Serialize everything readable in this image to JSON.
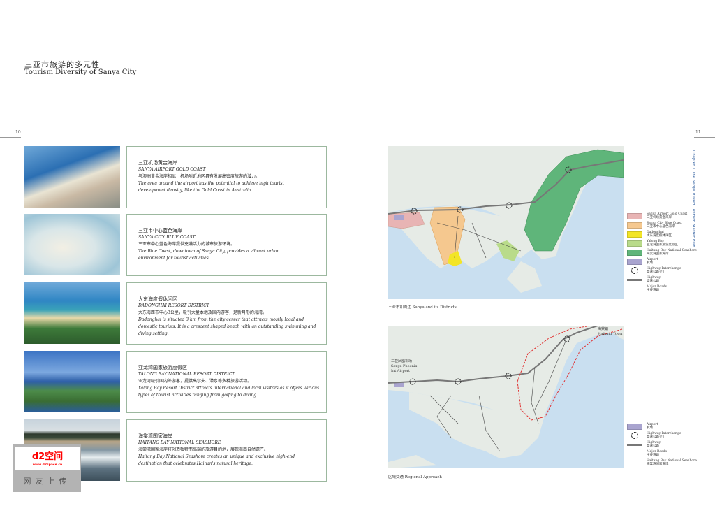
{
  "header": {
    "title_cn": "三亚市旅游的多元性",
    "title_en": "Tourism Diversity of Sanya City",
    "page_left": "10",
    "page_right": "11",
    "side_text": "Chapter 1 The Sanya Resort Tourism Master Plan"
  },
  "districts": [
    {
      "name_cn": "三亚机场黄金海岸",
      "name_en": "SANYA AIRPORT GOLD COAST",
      "desc_cn": "与澳洲黄金海岸相似，机场附近地区具有发展高密度旅游的潜力。",
      "desc_en": "The area around the airport has the potential to achieve high tourist development density, like the Gold Coast in Australia."
    },
    {
      "name_cn": "三亚市中心蓝色海岸",
      "name_en": "SANYA CITY BLUE COAST",
      "desc_cn": "三亚市中心蓝色海岸提供充满活力的城市旅游环境。",
      "desc_en": "The Blue Coast, downtown of Sanya City, provides a vibrant urban environment for tourist activities."
    },
    {
      "name_cn": "大东海度假休闲区",
      "name_en": "DADONGHAI RESORT DISTRICT",
      "desc_cn": "大东海距市中心3公里，吸引大量本地及国内游客，是新月形的海湾。",
      "desc_en": "Dadonghai is situated 3 km from the city center that attracts mostly local and domestic tourists. It is a crescent shaped beach with an outstanding swimming and diving setting."
    },
    {
      "name_cn": "亚龙湾国家旅游度假区",
      "name_en": "YALONG BAY NATIONAL RESORT DISTRICT",
      "desc_cn": "亚龙湾吸引国内外游客，提供高尔夫、潜水等多种旅游活动。",
      "desc_en": "Yalong Bay Resort District attracts international and local visitors as it offers various types of tourist activities ranging from golfing to diving."
    },
    {
      "name_cn": "海棠湾国家海岸",
      "name_en": "HAITANG BAY NATIONAL SEASHORE",
      "desc_cn": "海棠湾国家海岸将创造独特而高端的旅游目的地，展现海南自然遗产。",
      "desc_en": "Haitang Bay National Seashore creates an unique and exclusive high-end destination that celebrates Hainan's natural heritage."
    }
  ],
  "map1": {
    "caption": "三亚市和周边 Sanya and its Districts",
    "legend": [
      {
        "en": "Sanya Airport Gold Coast",
        "cn": "三亚机场黄金海岸",
        "color": "#e8b4b4"
      },
      {
        "en": "Sanya City Blue Coast",
        "cn": "三亚市中心蓝色海岸",
        "color": "#f5c88f"
      },
      {
        "en": "Dadonghai",
        "cn": "大东海度假休闲区",
        "color": "#f3e526"
      },
      {
        "en": "Yalong Bay",
        "cn": "亚龙湾国家旅游度假区",
        "color": "#b9db8a"
      },
      {
        "en": "Haitang Bay National Seashore",
        "cn": "海棠湾国家海岸",
        "color": "#5fb57a"
      },
      {
        "en": "Airport",
        "cn": "机场",
        "color": "#a9a4cf"
      },
      {
        "en": "Highway Interchange",
        "cn": "高速公路交汇",
        "color": ""
      },
      {
        "en": "Highway",
        "cn": "高速公路",
        "color": ""
      },
      {
        "en": "Major Roads",
        "cn": "主要道路",
        "color": ""
      }
    ]
  },
  "map2": {
    "caption": "区域交通 Regional Approach",
    "airport_label_cn": "三亚凤凰机场",
    "airport_label_en": "Sanya Phoenix Int Airport",
    "town_label_cn": "海棠镇",
    "town_label_en": "Haitang Town",
    "legend": [
      {
        "en": "Airport",
        "cn": "机场",
        "color": "#a9a4cf"
      },
      {
        "en": "Highway Interchange",
        "cn": "高速公路交汇",
        "color": ""
      },
      {
        "en": "Highway",
        "cn": "高速公路",
        "color": ""
      },
      {
        "en": "Major Roads",
        "cn": "主要道路",
        "color": ""
      },
      {
        "en": "Haitang Bay National Seashore",
        "cn": "海棠湾国家海岸",
        "color": "#e03030"
      }
    ]
  },
  "watermark": {
    "logo": "d2空间",
    "url": "www.d2space.cn",
    "text": "网友上传"
  }
}
